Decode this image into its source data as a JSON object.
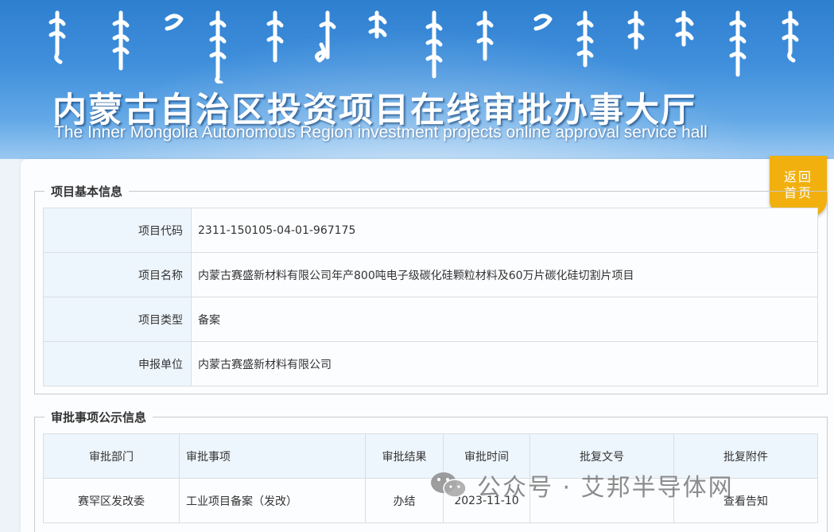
{
  "banner": {
    "title_cn": "内蒙古自治区投资项目在线审批办事大厅",
    "title_en": "The Inner Mongolia Autonomous Region investment projects online approval service hall"
  },
  "back_home": {
    "line1": "返回",
    "line2": "首页"
  },
  "basic_info": {
    "legend": "项目基本信息",
    "rows": [
      {
        "label": "项目代码",
        "value": "2311-150105-04-01-967175"
      },
      {
        "label": "项目名称",
        "value": "内蒙古赛盛新材料有限公司年产800吨电子级碳化硅颗粒材料及60万片碳化硅切割片项目"
      },
      {
        "label": "项目类型",
        "value": "备案"
      },
      {
        "label": "申报单位",
        "value": "内蒙古赛盛新材料有限公司"
      }
    ]
  },
  "approval": {
    "legend": "审批事项公示信息",
    "headers": [
      "审批部门",
      "审批事项",
      "审批结果",
      "审批时间",
      "批复文号",
      "批复附件"
    ],
    "rows": [
      {
        "dept": "赛罕区发改委",
        "item": "工业项目备案（发改）",
        "result": "办结",
        "time": "2023-11-10",
        "doc_no": "",
        "attachment": "查看告知"
      }
    ]
  },
  "watermark": {
    "text": "公众号 · 艾邦半导体网",
    "icon": "wechat-icon"
  },
  "colors": {
    "header_accent": "#3f8fdc",
    "back_home": "#f1b00e",
    "label_bg": "#eef6fd"
  }
}
